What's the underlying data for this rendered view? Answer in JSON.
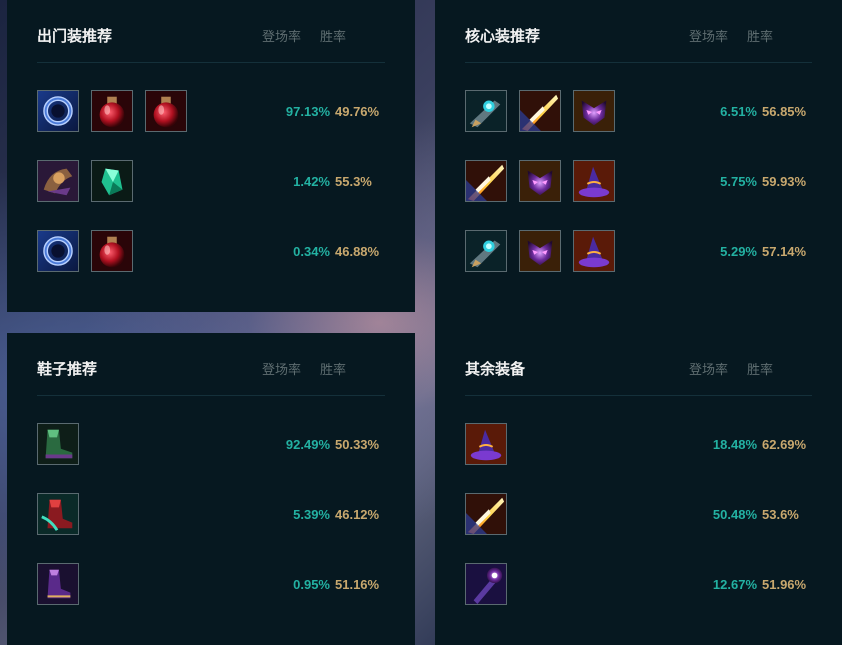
{
  "colors": {
    "rate": "#23b1a2",
    "win": "#c8a86e",
    "panel": "#061820",
    "header": "#5e6d70"
  },
  "col_labels": {
    "rate": "登场率",
    "win": "胜率"
  },
  "panels": [
    {
      "title": "出门装推荐",
      "rows": [
        {
          "icons": [
            "dark-seal-ring-icon",
            "red-potion-icon",
            "red-potion-icon"
          ],
          "rate": "97.13%",
          "win": "49.76%"
        },
        {
          "icons": [
            "spellthief-shoulder-icon",
            "green-crystal-icon"
          ],
          "rate": "1.42%",
          "win": "55.3%"
        },
        {
          "icons": [
            "dark-seal-ring-icon",
            "red-potion-icon"
          ],
          "rate": "0.34%",
          "win": "46.88%"
        }
      ]
    },
    {
      "title": "核心装推荐",
      "rows": [
        {
          "icons": [
            "hextech-gunblade-icon",
            "flame-sword-icon",
            "purple-mask-icon"
          ],
          "rate": "6.51%",
          "win": "56.85%"
        },
        {
          "icons": [
            "flame-sword-icon",
            "purple-mask-icon",
            "wizard-hat-icon"
          ],
          "rate": "5.75%",
          "win": "59.93%"
        },
        {
          "icons": [
            "hextech-gunblade-icon",
            "purple-mask-icon",
            "wizard-hat-icon"
          ],
          "rate": "5.29%",
          "win": "57.14%"
        }
      ]
    },
    {
      "title": "鞋子推荐",
      "rows": [
        {
          "icons": [
            "sorcerer-shoes-icon"
          ],
          "rate": "92.49%",
          "win": "50.33%"
        },
        {
          "icons": [
            "mercury-treads-icon"
          ],
          "rate": "5.39%",
          "win": "46.12%"
        },
        {
          "icons": [
            "ionian-boots-icon"
          ],
          "rate": "0.95%",
          "win": "51.16%"
        }
      ]
    },
    {
      "title": "其余装备",
      "rows": [
        {
          "icons": [
            "wizard-hat-icon"
          ],
          "rate": "18.48%",
          "win": "62.69%"
        },
        {
          "icons": [
            "flame-sword-icon"
          ],
          "rate": "50.48%",
          "win": "53.6%"
        },
        {
          "icons": [
            "void-staff-icon"
          ],
          "rate": "12.67%",
          "win": "51.96%"
        }
      ]
    }
  ]
}
